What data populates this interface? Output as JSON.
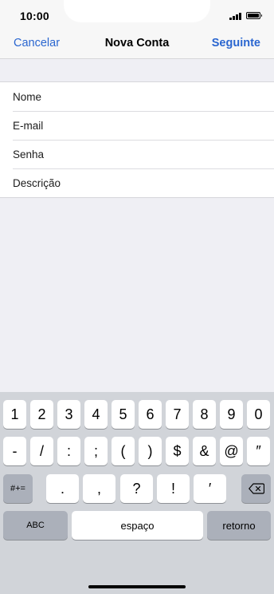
{
  "status_bar": {
    "time": "10:00"
  },
  "nav": {
    "cancel_label": "Cancelar",
    "title": "Nova Conta",
    "next_label": "Seguinte"
  },
  "form": {
    "fields": [
      {
        "placeholder": "Nome",
        "value": ""
      },
      {
        "placeholder": "E-mail",
        "value": ""
      },
      {
        "placeholder": "Senha",
        "value": ""
      },
      {
        "placeholder": "Descrição",
        "value": ""
      }
    ]
  },
  "keyboard": {
    "row1": [
      "1",
      "2",
      "3",
      "4",
      "5",
      "6",
      "7",
      "8",
      "9",
      "0"
    ],
    "row2": [
      "-",
      "/",
      ":",
      ";",
      "(",
      ")",
      "$",
      "&",
      "@",
      "″"
    ],
    "row3": {
      "symbols_toggle": "#+=",
      "keys": [
        ".",
        ",",
        "?",
        "!",
        "′"
      ],
      "delete_icon": "backspace-icon"
    },
    "row4": {
      "abc": "ABC",
      "space": "espaço",
      "return": "retorno"
    }
  },
  "colors": {
    "accent": "#2a66d0",
    "keyboard_bg": "#d1d4d9",
    "page_bg": "#efeff4"
  }
}
